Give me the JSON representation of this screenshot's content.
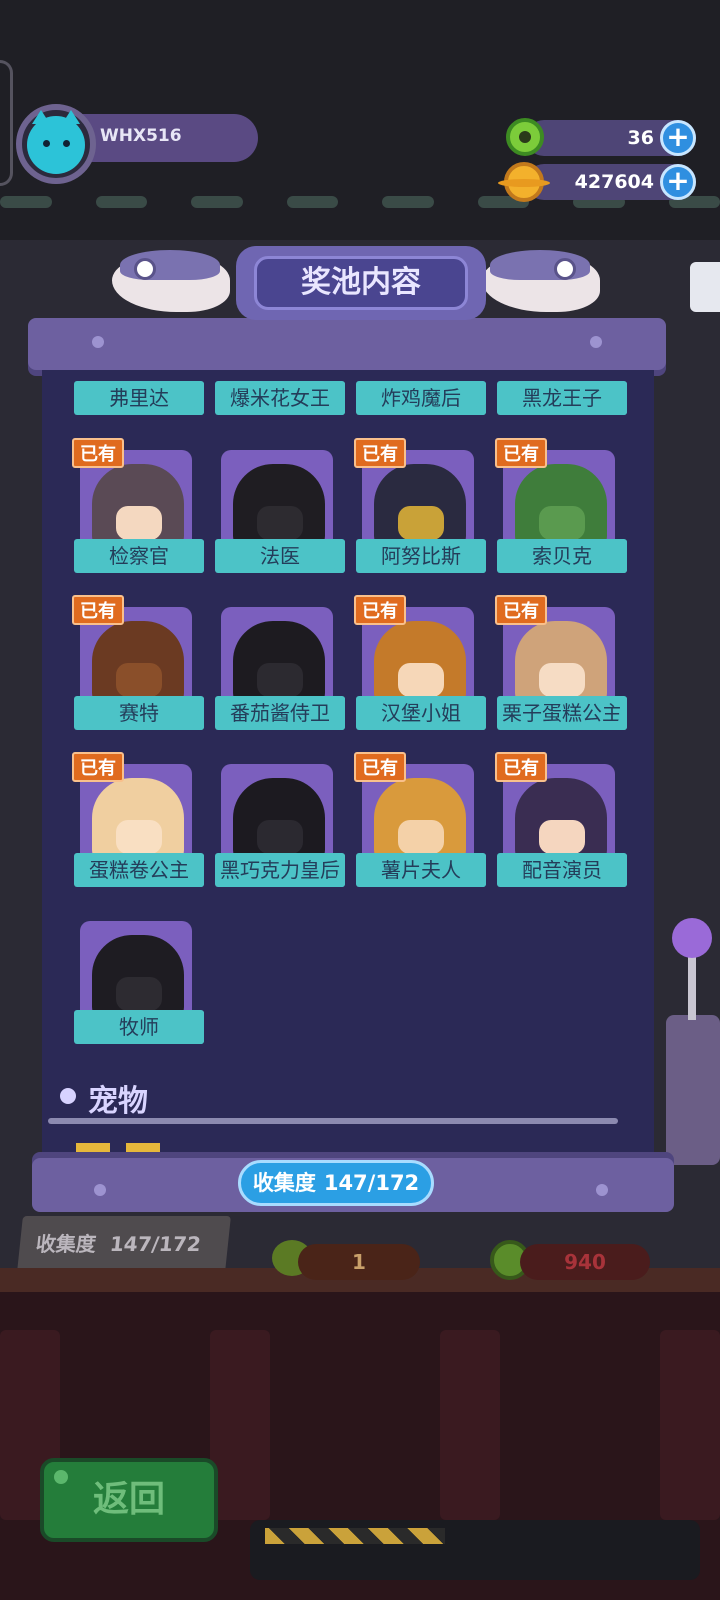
{
  "hud": {
    "username": "WHX516",
    "gems": "36",
    "coins": "427604",
    "gem_icon": "green-donut-icon",
    "coin_icon": "gold-planet-coin-icon",
    "plus_symbol": "+"
  },
  "panel": {
    "title": "奖池内容",
    "section_pets": "宠物",
    "collection_label": "收集度",
    "collection_value": "147/172"
  },
  "top_row": [
    "弗里达",
    "爆米花女王",
    "炸鸡魔后",
    "黑龙王子"
  ],
  "owned_badge": "已有",
  "characters": [
    {
      "name": "检察官",
      "owned": true,
      "color": "#5a4a55",
      "face": "#f4d8c0"
    },
    {
      "name": "法医",
      "owned": false,
      "color": "#1f1d22",
      "face": "#2d2b30"
    },
    {
      "name": "阿努比斯",
      "owned": true,
      "color": "#2a2a40",
      "face": "#c9a238"
    },
    {
      "name": "索贝克",
      "owned": true,
      "color": "#3f7d3b",
      "face": "#5a9a4f"
    },
    {
      "name": "赛特",
      "owned": true,
      "color": "#6b3a22",
      "face": "#8a4f2a"
    },
    {
      "name": "番茄酱侍卫",
      "owned": false,
      "color": "#1d1b20",
      "face": "#2c2a30"
    },
    {
      "name": "汉堡小姐",
      "owned": true,
      "color": "#c47a2a",
      "face": "#f6d7b8"
    },
    {
      "name": "栗子蛋糕公主",
      "owned": true,
      "color": "#cfa37a",
      "face": "#f6dcc4"
    },
    {
      "name": "蛋糕卷公主",
      "owned": true,
      "color": "#f0cfa0",
      "face": "#f9dfc2"
    },
    {
      "name": "黑巧克力皇后",
      "owned": false,
      "color": "#1c1a20",
      "face": "#2b2930"
    },
    {
      "name": "薯片夫人",
      "owned": true,
      "color": "#d99a3c",
      "face": "#f4d1a8"
    },
    {
      "name": "配音演员",
      "owned": true,
      "color": "#3a2d52",
      "face": "#f5d6bf"
    },
    {
      "name": "牧师",
      "owned": false,
      "color": "#1e1c22",
      "face": "#2d2b31"
    }
  ],
  "background": {
    "collect_label": "收集度",
    "collect_value": "147/172",
    "count_1": "1",
    "count_2": "940",
    "back_button": "返回"
  }
}
